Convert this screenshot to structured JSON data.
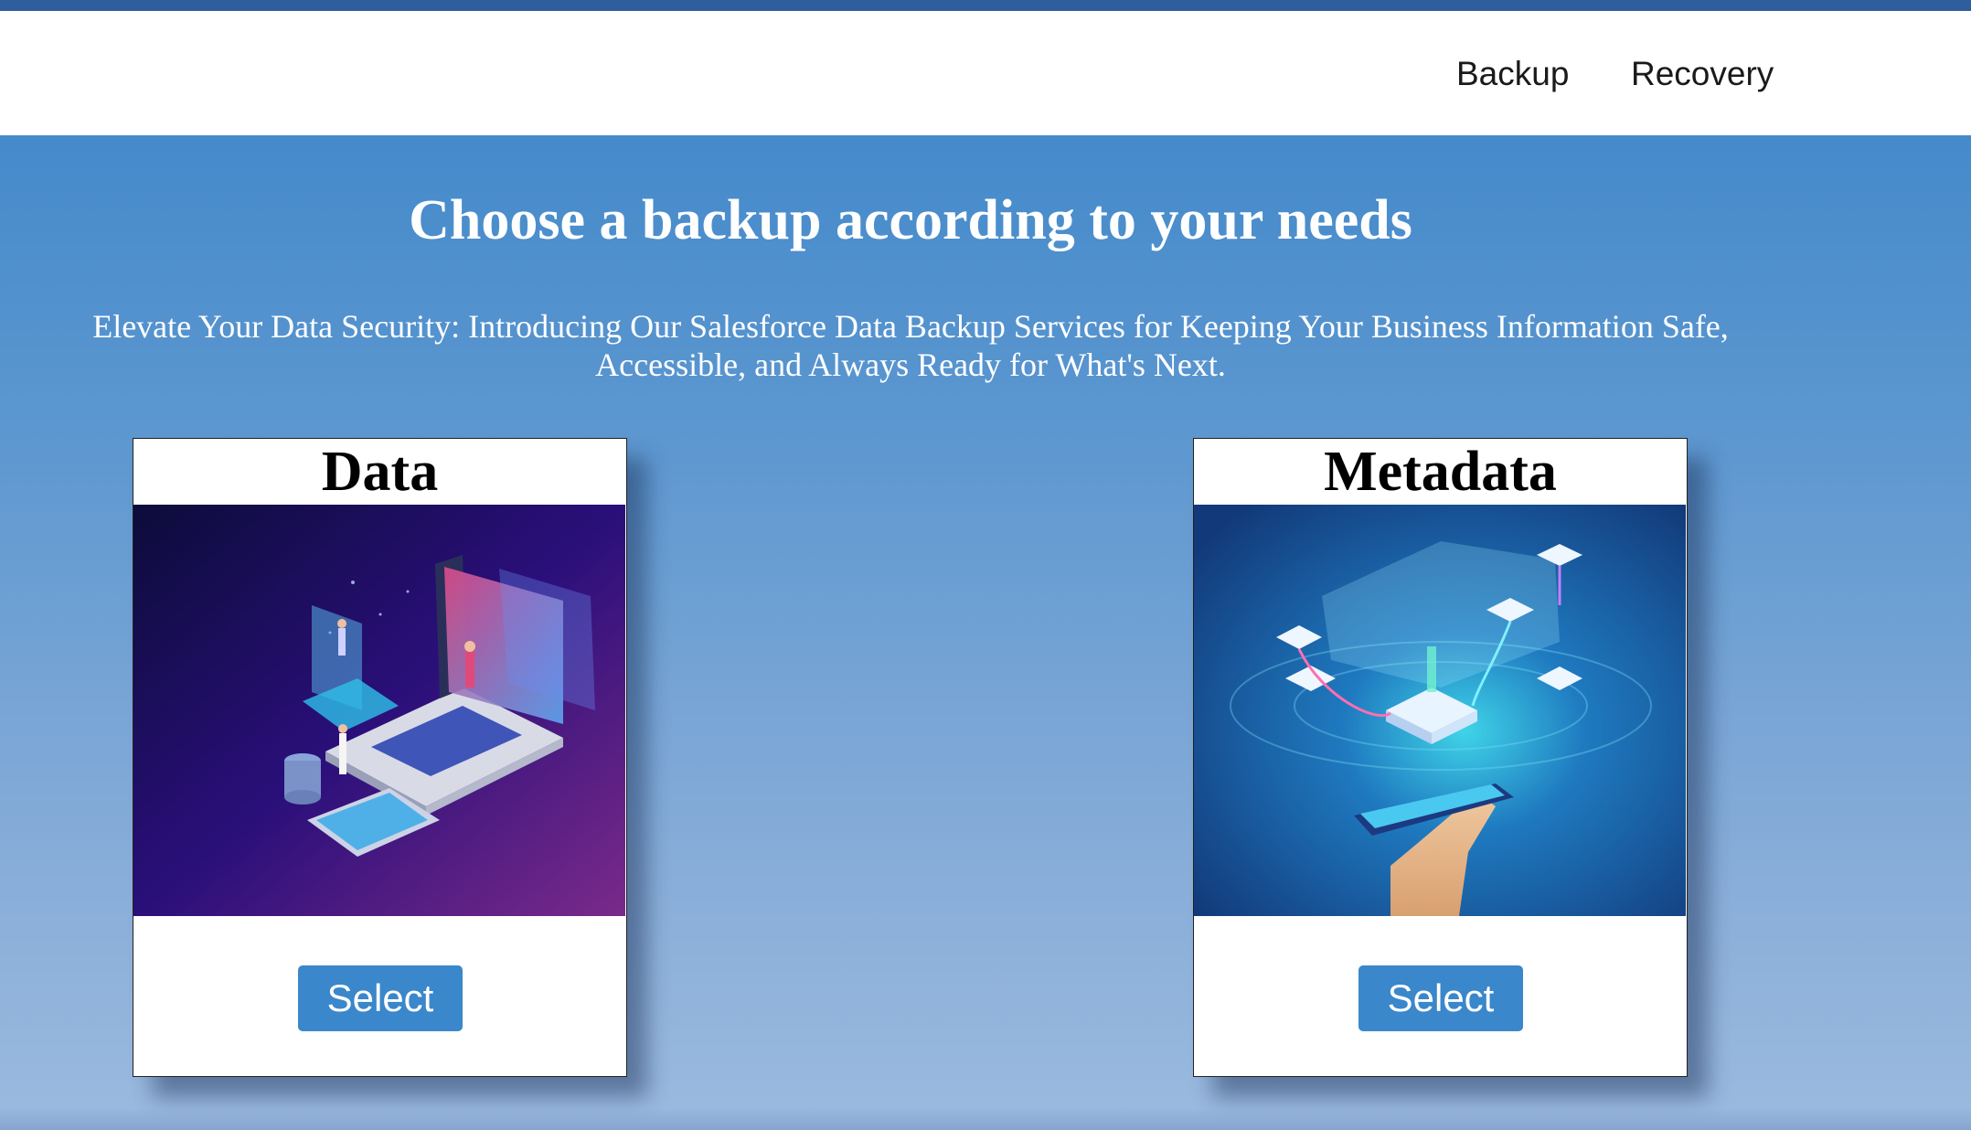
{
  "nav": {
    "backup_label": "Backup",
    "recovery_label": "Recovery"
  },
  "hero": {
    "title": "Choose a backup according to your needs",
    "subtitle": "Elevate Your Data Security: Introducing Our Salesforce Data Backup Services for Keeping Your Business Information Safe, Accessible, and Always Ready for What's Next."
  },
  "cards": [
    {
      "title": "Data",
      "button_label": "Select",
      "image_icon": "laptop-data-illustration"
    },
    {
      "title": "Metadata",
      "button_label": "Select",
      "image_icon": "cloud-network-illustration"
    }
  ],
  "colors": {
    "accent": "#3a87cb",
    "nav_strip": "#2f5e9e",
    "background_top": "#3a84c9",
    "background_bottom": "#9bbadf"
  }
}
